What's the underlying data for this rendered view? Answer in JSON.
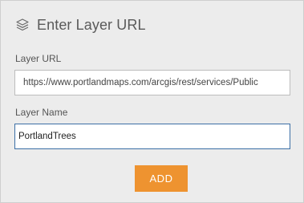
{
  "panel": {
    "title": "Enter Layer URL",
    "title_icon": "layers-icon"
  },
  "layer_url": {
    "label": "Layer URL",
    "value": "https://www.portlandmaps.com/arcgis/rest/services/Public"
  },
  "layer_name": {
    "label": "Layer Name",
    "value": "PortlandTrees"
  },
  "add_button": {
    "label": "ADD",
    "color": "#ee9330"
  },
  "colors": {
    "panel_background": "#ececec",
    "focused_border": "#3c6fa6"
  }
}
